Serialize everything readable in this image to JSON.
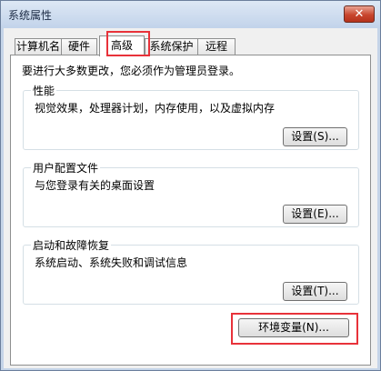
{
  "window": {
    "title": "系统属性",
    "close_symbol": "✕"
  },
  "tabs": [
    {
      "label": "计算机名"
    },
    {
      "label": "硬件"
    },
    {
      "label": "高级"
    },
    {
      "label": "系统保护"
    },
    {
      "label": "远程"
    }
  ],
  "active_tab": "高级",
  "notice": "要进行大多数更改，您必须作为管理员登录。",
  "groups": {
    "performance": {
      "label": "性能",
      "description": "视觉效果，处理器计划，内存使用，以及虚拟内存",
      "button": "设置(S)..."
    },
    "user_profiles": {
      "label": "用户配置文件",
      "description": "与您登录有关的桌面设置",
      "button": "设置(E)..."
    },
    "startup_recovery": {
      "label": "启动和故障恢复",
      "description": "系统启动、系统失败和调试信息",
      "button": "设置(T)..."
    }
  },
  "env_button": "环境变量(N)...",
  "colors": {
    "highlight": "#e8323a",
    "close_button": "#c8452e"
  }
}
